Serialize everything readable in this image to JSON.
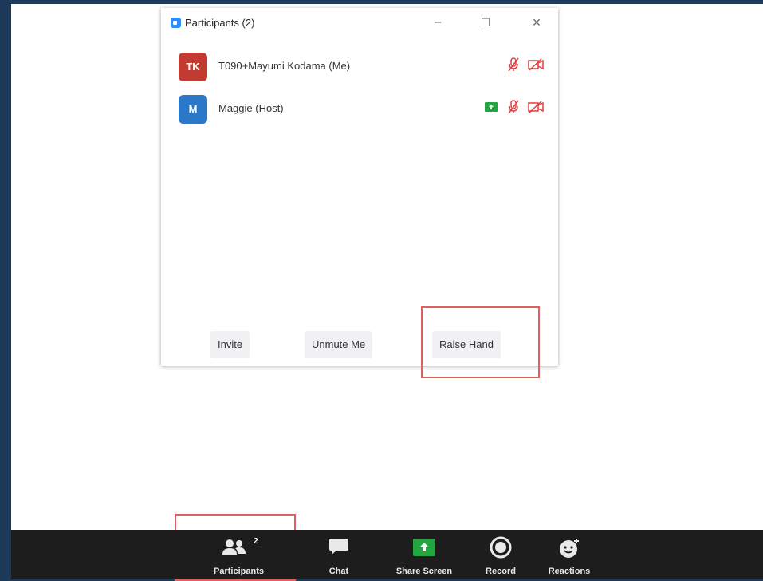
{
  "window": {
    "title": "Participants (2)",
    "minimize_label": "–",
    "maximize_label": "☐",
    "close_label": "×"
  },
  "participants": [
    {
      "initials": "TK",
      "name": "T090+Mayumi Kodama (Me)",
      "avatar_color": "#c23b32",
      "screen_share": false,
      "muted": true,
      "video_off": true
    },
    {
      "initials": "M",
      "name": "Maggie (Host)",
      "avatar_color": "#2b78c8",
      "screen_share": true,
      "muted": true,
      "video_off": true
    }
  ],
  "footer": {
    "invite": "Invite",
    "unmute": "Unmute Me",
    "raise_hand": "Raise Hand"
  },
  "toolbar": {
    "participants_label": "Participants",
    "participants_count": "2",
    "chat_label": "Chat",
    "share_label": "Share Screen",
    "record_label": "Record",
    "reactions_label": "Reactions"
  },
  "colors": {
    "accent_red": "#e04040",
    "share_green": "#23a53f",
    "highlight": "#e06060"
  }
}
